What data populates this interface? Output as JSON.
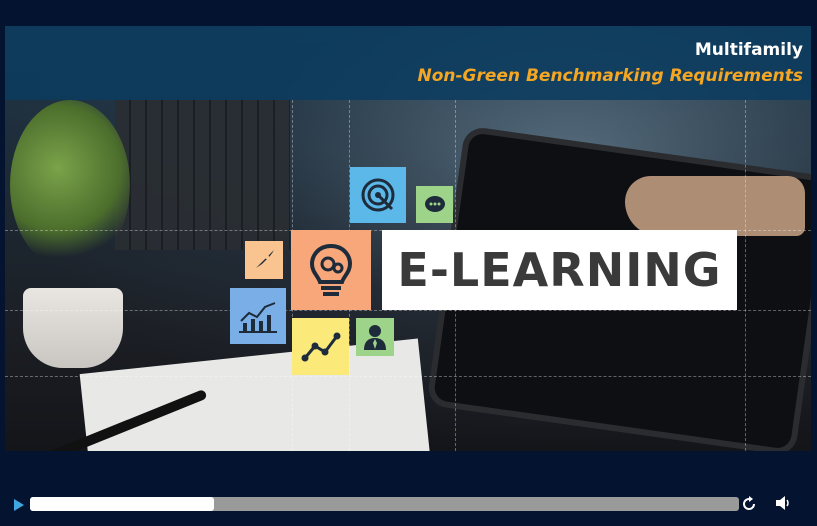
{
  "slide": {
    "title": "Multifamily",
    "subtitle": "Non-Green Benchmarking Requirements",
    "banner_text": "E-LEARNING"
  },
  "icons": [
    "target-icon",
    "chat-icon",
    "rocket-icon",
    "lightbulb-gears-icon",
    "chart-icon",
    "graph-line-icon",
    "person-icon"
  ],
  "player": {
    "progress_fraction": 0.26,
    "play_icon": "play-icon",
    "replay_icon": "replay-icon",
    "volume_icon": "volume-icon"
  },
  "colors": {
    "subtitle_color": "#f5a623",
    "header_band": "#0b3c5f",
    "background": "#041430",
    "tile_blue": "#5bb8e8",
    "tile_green": "#9ed48a",
    "tile_orange": "#f7b27d",
    "tile_yellow": "#fbe97a",
    "tile_lightblue": "#7aaee6",
    "tile_peach": "#f9c48f"
  }
}
